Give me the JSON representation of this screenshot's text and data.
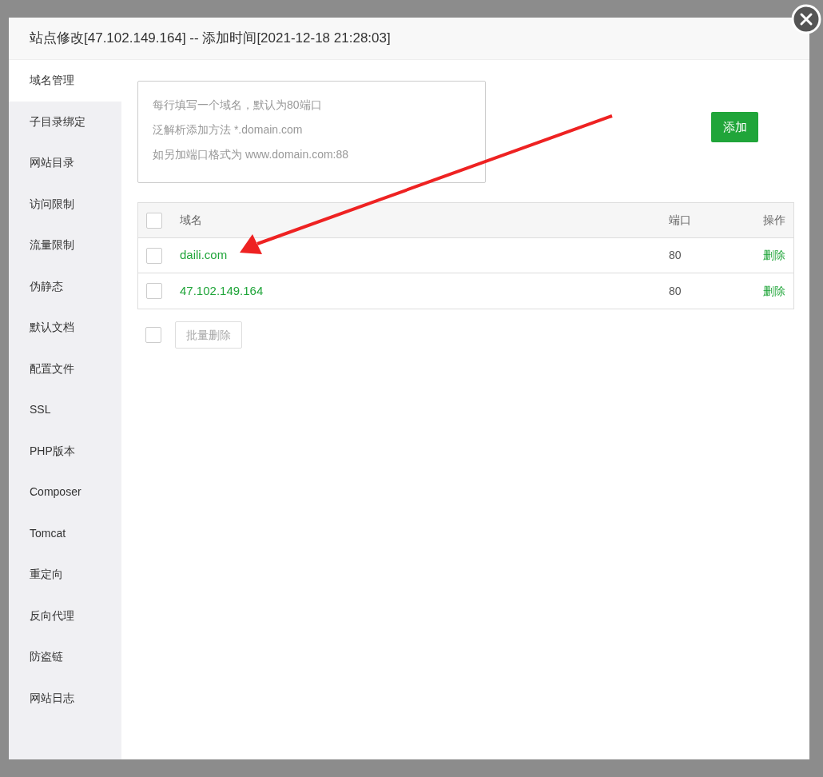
{
  "dialog": {
    "title": "站点修改[47.102.149.164] -- 添加时间[2021-12-18 21:28:03]"
  },
  "sidebar": {
    "items": [
      {
        "label": "域名管理",
        "selected": true
      },
      {
        "label": "子目录绑定",
        "selected": false
      },
      {
        "label": "网站目录",
        "selected": false
      },
      {
        "label": "访问限制",
        "selected": false
      },
      {
        "label": "流量限制",
        "selected": false
      },
      {
        "label": "伪静态",
        "selected": false
      },
      {
        "label": "默认文档",
        "selected": false
      },
      {
        "label": "配置文件",
        "selected": false
      },
      {
        "label": "SSL",
        "selected": false
      },
      {
        "label": "PHP版本",
        "selected": false
      },
      {
        "label": "Composer",
        "selected": false
      },
      {
        "label": "Tomcat",
        "selected": false
      },
      {
        "label": "重定向",
        "selected": false
      },
      {
        "label": "反向代理",
        "selected": false
      },
      {
        "label": "防盗链",
        "selected": false
      },
      {
        "label": "网站日志",
        "selected": false
      }
    ]
  },
  "domain_input": {
    "placeholder_lines": [
      "每行填写一个域名，默认为80端口",
      "泛解析添加方法 *.domain.com",
      "如另加端口格式为 www.domain.com:88"
    ]
  },
  "add_button": "添加",
  "table": {
    "header_checked": false,
    "columns": [
      "域名",
      "端口",
      "操作"
    ],
    "rows": [
      {
        "checked": false,
        "domain": "daili.com",
        "port": "80",
        "action": "删除"
      },
      {
        "checked": false,
        "domain": "47.102.149.164",
        "port": "80",
        "action": "删除"
      }
    ]
  },
  "batch": {
    "checked": false,
    "button": "批量删除",
    "disabled": true
  }
}
